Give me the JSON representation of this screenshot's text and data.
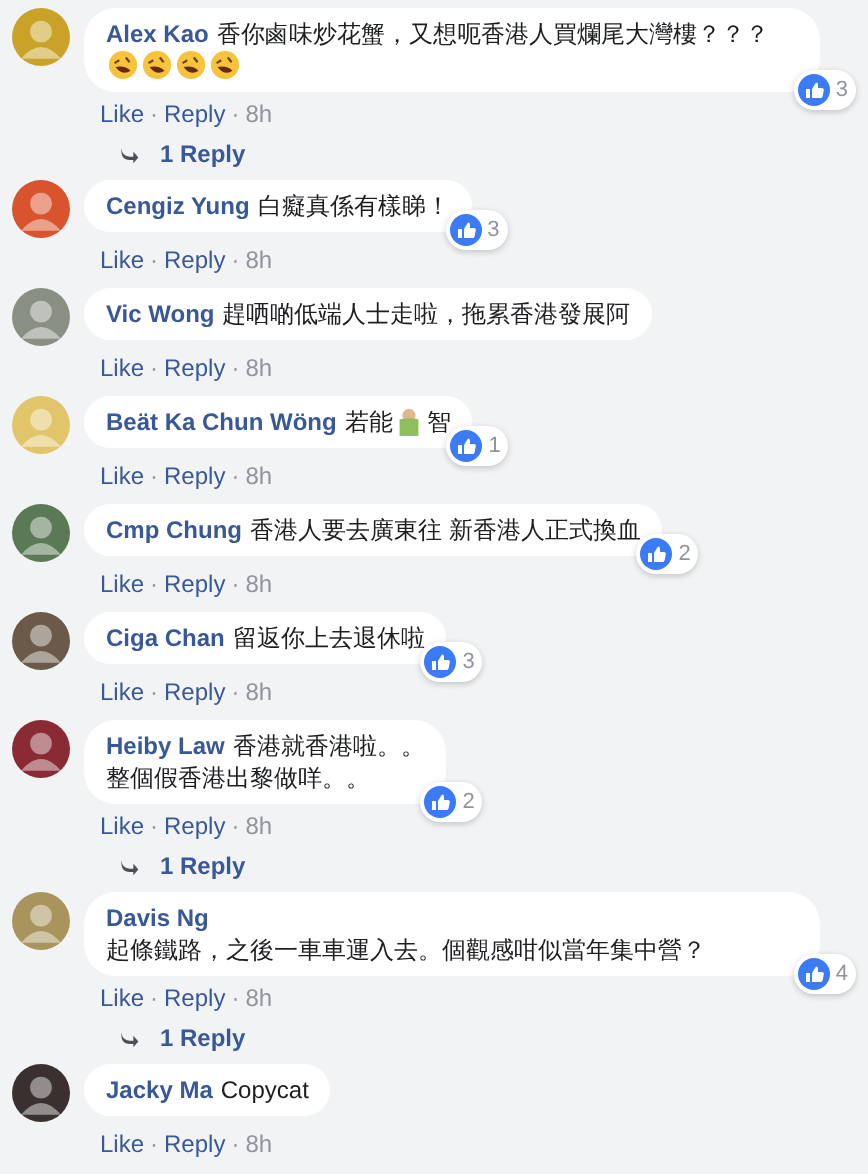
{
  "comments": [
    {
      "author": "Alex Kao",
      "color": "#c9a227",
      "parts": [
        {
          "kind": "text",
          "text": "香你鹵味炒花蟹，又想呃香港人買爛尾大灣樓？？？"
        },
        {
          "kind": "laugh"
        },
        {
          "kind": "laugh"
        },
        {
          "kind": "laugh"
        },
        {
          "kind": "laugh"
        }
      ],
      "likes": "3",
      "actions": [
        "Like",
        "Reply"
      ],
      "separator": "·",
      "time": "8h",
      "replies": "1 Reply"
    },
    {
      "author": "Cengiz Yung",
      "color": "#d9532c",
      "parts": [
        {
          "kind": "text",
          "text": "白癡真係有樣睇！"
        }
      ],
      "likes": "3",
      "actions": [
        "Like",
        "Reply"
      ],
      "separator": "·",
      "time": "8h"
    },
    {
      "author": "Vic Wong",
      "color": "#8a8f86",
      "parts": [
        {
          "kind": "text",
          "text": "趕哂啲低端人士走啦，拖累香港發展阿"
        }
      ],
      "actions": [
        "Like",
        "Reply"
      ],
      "separator": "·",
      "time": "8h"
    },
    {
      "author": "Beät Ka Chun Wöng",
      "color": "#e2c56a",
      "parts": [
        {
          "kind": "text",
          "text": "若能"
        },
        {
          "kind": "person"
        },
        {
          "kind": "text",
          "text": "智"
        }
      ],
      "likes": "1",
      "actions": [
        "Like",
        "Reply"
      ],
      "separator": "·",
      "time": "8h"
    },
    {
      "author": "Cmp Chung",
      "color": "#5a7a55",
      "parts": [
        {
          "kind": "text",
          "text": "香港人要去廣東往 新香港人正式換血"
        }
      ],
      "likes": "2",
      "actions": [
        "Like",
        "Reply"
      ],
      "separator": "·",
      "time": "8h"
    },
    {
      "author": "Ciga Chan",
      "color": "#6b5a4a",
      "parts": [
        {
          "kind": "text",
          "text": "留返你上去退休啦"
        }
      ],
      "likes": "3",
      "actions": [
        "Like",
        "Reply"
      ],
      "separator": "·",
      "time": "8h"
    },
    {
      "author": "Heiby Law",
      "color": "#8a2a35",
      "parts": [
        {
          "kind": "text",
          "text": "香港就香港啦。。"
        },
        {
          "kind": "break"
        },
        {
          "kind": "text",
          "text": "整個假香港出黎做咩。。"
        }
      ],
      "likes": "2",
      "actions": [
        "Like",
        "Reply"
      ],
      "separator": "·",
      "time": "8h",
      "replies": "1 Reply"
    },
    {
      "author": "Davis Ng",
      "color": "#a8945c",
      "parts": [
        {
          "kind": "text",
          "text": "起條鐵路，之後一車車運入去。個觀感咁似當年集中營？"
        }
      ],
      "likes": "4",
      "actions": [
        "Like",
        "Reply"
      ],
      "separator": "·",
      "time": "8h",
      "replies": "1 Reply"
    },
    {
      "author": "Jacky Ma",
      "color": "#3a3030",
      "parts": [
        {
          "kind": "text",
          "text": "Copycat"
        }
      ],
      "actions": [
        "Like",
        "Reply"
      ],
      "separator": "·",
      "time": "8h"
    }
  ]
}
